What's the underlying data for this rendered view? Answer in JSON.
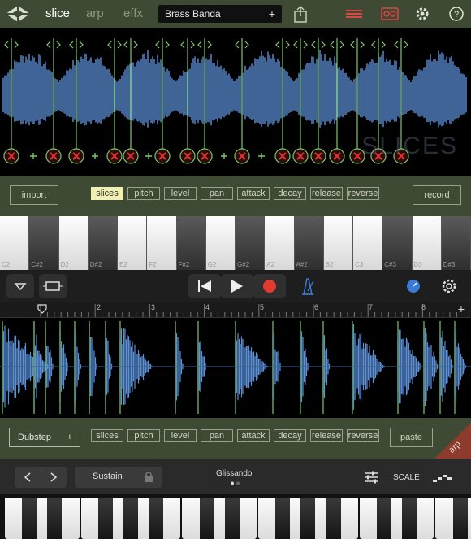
{
  "top": {
    "tabs": [
      "slice",
      "arp",
      "effx"
    ],
    "active_tab": "slice",
    "preset_name": "Brass Banda",
    "preset_add": "+",
    "icons": [
      "logo-icon",
      "share-icon",
      "piano-roll-icon",
      "tape-icon",
      "gear-icon",
      "help-icon"
    ]
  },
  "slice_panel": {
    "watermark": "SLICES",
    "import_label": "import",
    "record_label": "record",
    "params": [
      "slices",
      "pitch",
      "level",
      "pan",
      "attack",
      "decay",
      "release",
      "reverse"
    ],
    "active_param": "slices"
  },
  "piano_top": {
    "keys": [
      {
        "label": "C2",
        "black": false
      },
      {
        "label": "C#2",
        "black": true
      },
      {
        "label": "D2",
        "black": false
      },
      {
        "label": "D#2",
        "black": true
      },
      {
        "label": "E2",
        "black": false
      },
      {
        "label": "F2",
        "black": false
      },
      {
        "label": "F#2",
        "black": true
      },
      {
        "label": "G2",
        "black": false
      },
      {
        "label": "G#2",
        "black": true
      },
      {
        "label": "A2",
        "black": false
      },
      {
        "label": "A#2",
        "black": true
      },
      {
        "label": "B2",
        "black": false
      },
      {
        "label": "C3",
        "black": false
      },
      {
        "label": "C#3",
        "black": true
      },
      {
        "label": "D3",
        "black": false
      },
      {
        "label": "D#3",
        "black": true
      }
    ]
  },
  "transport": {
    "icons": [
      "collapse-icon",
      "loop-icon",
      "rewind-icon",
      "play-icon",
      "record-icon",
      "metronome-icon",
      "tuner-icon",
      "settings-icon"
    ]
  },
  "ruler": {
    "bars": [
      "2",
      "3",
      "4",
      "5",
      "6",
      "7",
      "8"
    ],
    "add": "+"
  },
  "arp_panel": {
    "pattern": "Dubstep",
    "pattern_add": "+",
    "params": [
      "slices",
      "pitch",
      "level",
      "pan",
      "attack",
      "decay",
      "release",
      "reverse"
    ],
    "paste_label": "paste",
    "corner_label": "arp"
  },
  "controls": {
    "sustain_label": "Sustain",
    "glissando_label": "Glissando",
    "scale_label": "SCALE"
  },
  "colors": {
    "panel": "#3f4a35",
    "wave": "#5b8fd6",
    "slice_line": "#7ec86a",
    "marker_red": "#e0312e",
    "active_param": "#f1f0b4",
    "record_red": "#e53a2f",
    "accent_blue": "#3a7bd5"
  }
}
